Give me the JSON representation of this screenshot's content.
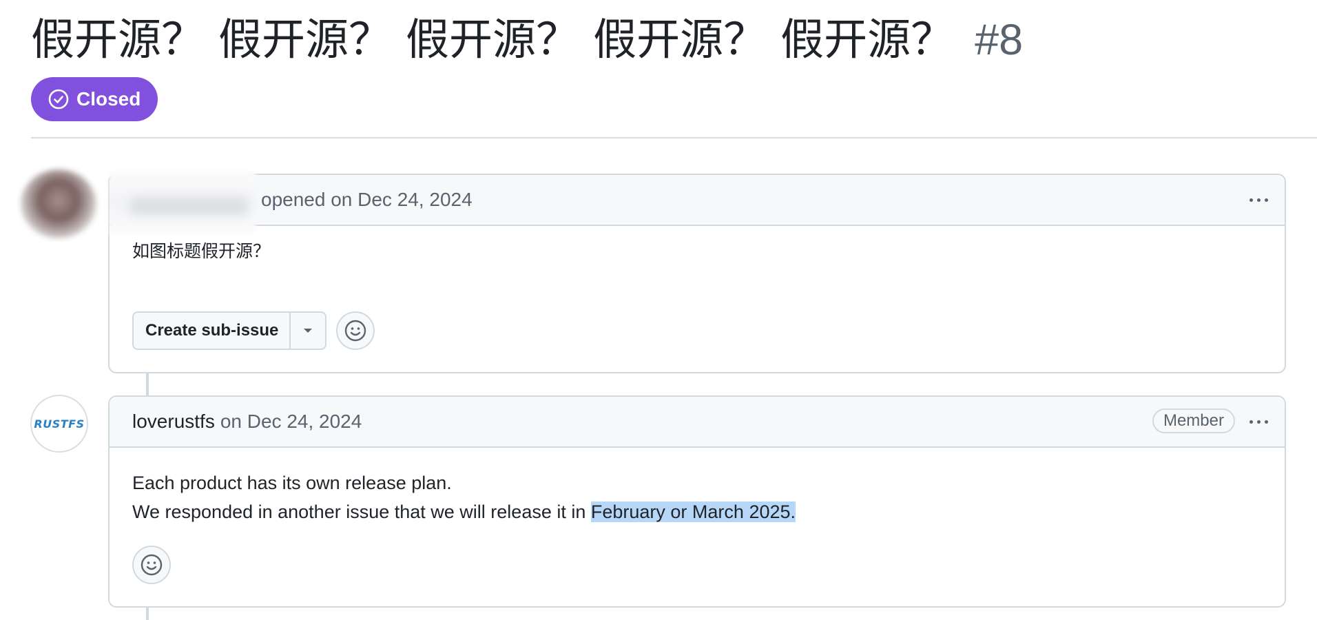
{
  "issue": {
    "title": "假开源？ 假开源？ 假开源？ 假开源？ 假开源？",
    "number": "#8",
    "state": "Closed"
  },
  "comments": [
    {
      "author": "",
      "action": "opened on Dec 24, 2024",
      "body": "如图标题假开源？",
      "sub_issue_label": "Create sub-issue"
    },
    {
      "author": "loverustfs",
      "action": "on Dec 24, 2024",
      "role": "Member",
      "avatar_text": "RUSTFS",
      "body_line_1": "Each product has its own release plan.",
      "body_line_2_prefix": "We responded in another issue that we will release it in ",
      "body_line_2_highlight": "February or March 2025."
    }
  ],
  "colors": {
    "closed_badge": "#8250df",
    "selection_highlight": "#b6d7f8",
    "border": "#d1d9e0",
    "header_bg": "#f6f8fa"
  },
  "icons": {
    "state": "check-circle-icon",
    "menu": "kebab-horizontal-icon",
    "dropdown": "triangle-down-icon",
    "reaction": "smiley-icon"
  }
}
